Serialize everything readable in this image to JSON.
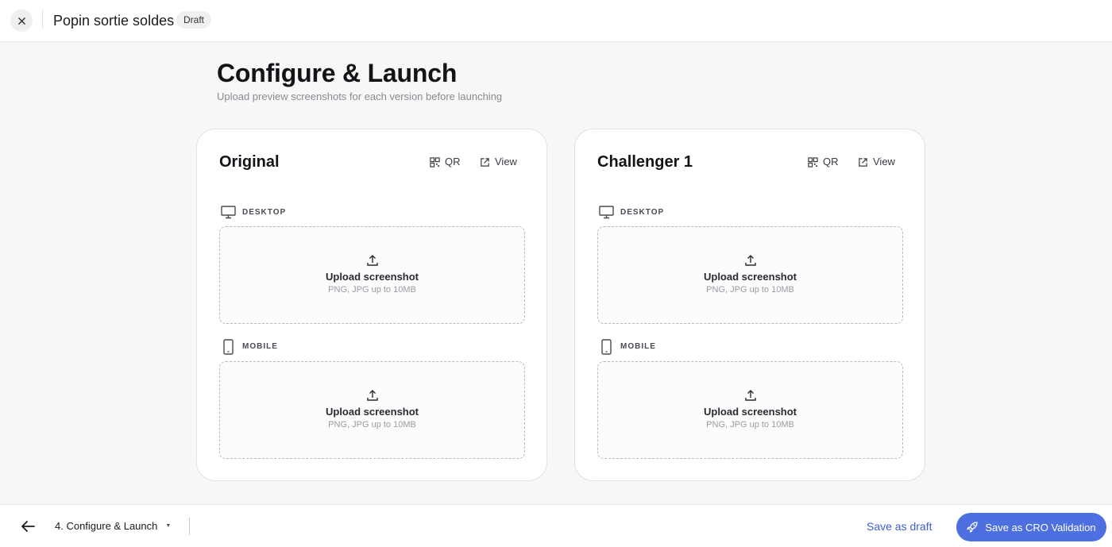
{
  "header": {
    "close_icon": "close-icon",
    "title": "Popin sortie soldes",
    "status_badge": "Draft"
  },
  "page": {
    "title": "Configure & Launch",
    "subtitle": "Upload preview screenshots for each version before launching"
  },
  "versions": [
    {
      "name": "Original",
      "qr_label": "QR",
      "view_label": "View",
      "sections": [
        {
          "label": "DESKTOP",
          "icon": "monitor-icon",
          "upload_title": "Upload screenshot",
          "upload_hint": "PNG, JPG up to 10MB"
        },
        {
          "label": "MOBILE",
          "icon": "phone-icon",
          "upload_title": "Upload screenshot",
          "upload_hint": "PNG, JPG up to 10MB"
        }
      ]
    },
    {
      "name": "Challenger 1",
      "qr_label": "QR",
      "view_label": "View",
      "sections": [
        {
          "label": "DESKTOP",
          "icon": "monitor-icon",
          "upload_title": "Upload screenshot",
          "upload_hint": "PNG, JPG up to 10MB"
        },
        {
          "label": "MOBILE",
          "icon": "phone-icon",
          "upload_title": "Upload screenshot",
          "upload_hint": "PNG, JPG up to 10MB"
        }
      ]
    }
  ],
  "footer": {
    "back_icon": "arrow-left-icon",
    "step_label": "4. Configure & Launch",
    "save_draft_label": "Save as draft",
    "save_cro_label": "Save as CRO Validation",
    "save_cro_icon": "rocket-icon"
  },
  "colors": {
    "accent": "#4e6fe0",
    "link": "#3d5fd1",
    "background": "#f7f7f8"
  }
}
